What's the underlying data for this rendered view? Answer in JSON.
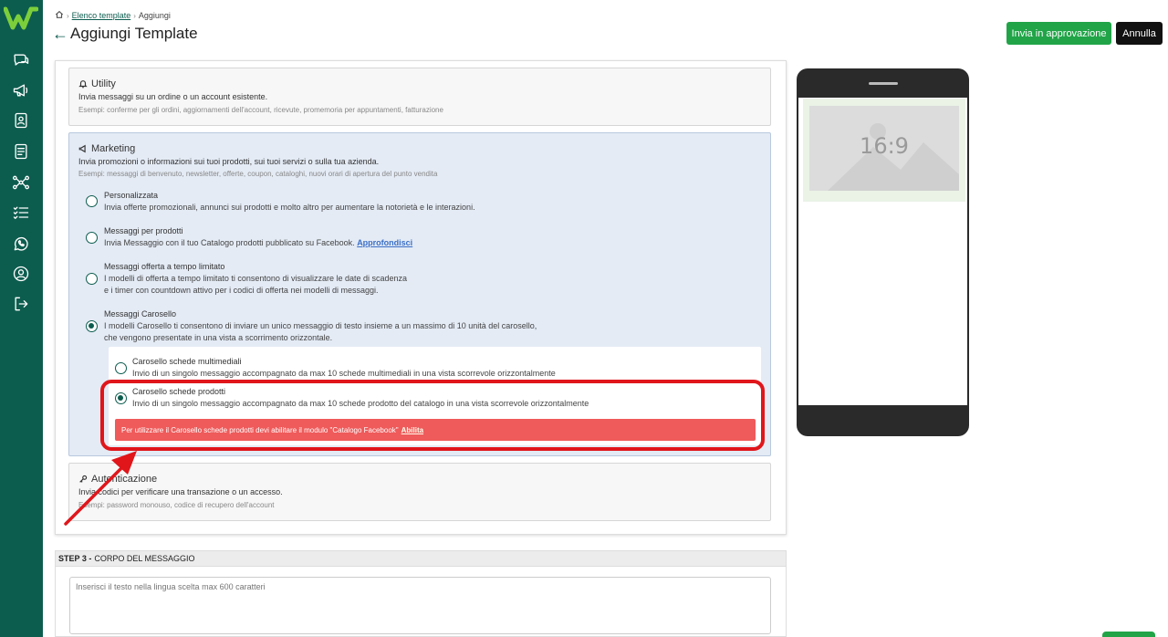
{
  "breadcrumb": {
    "link": "Elenco template",
    "current": "Aggiungi"
  },
  "page": {
    "title": "Aggiungi Template"
  },
  "actions": {
    "approve_label": "Invia in approvazione",
    "cancel_label": "Annulla"
  },
  "categories": {
    "utility": {
      "title": "Utility",
      "desc": "Invia messaggi su un ordine o un account esistente.",
      "example": "Esempi: conferme per gli ordini, aggiornamenti dell'account, ricevute, promemoria per appuntamenti, fatturazione"
    },
    "marketing": {
      "title": "Marketing",
      "desc": "Invia promozioni o informazioni sui tuoi prodotti, sui tuoi servizi o sulla tua azienda.",
      "example": "Esempi: messaggi di benvenuto, newsletter, offerte, coupon, cataloghi, nuovi orari di apertura del punto vendita",
      "options": [
        {
          "title": "Personalizzata",
          "desc": "Invia offerte promozionali, annunci sui prodotti e molto altro per aumentare la notorietà e le interazioni.",
          "checked": false
        },
        {
          "title": "Messaggi per prodotti",
          "desc": "Invia Messaggio con il tuo Catalogo prodotti pubblicato su Facebook.",
          "link": "Approfondisci",
          "checked": false
        },
        {
          "title": "Messaggi offerta a tempo limitato",
          "desc1": "I modelli di offerta a tempo limitato ti consentono di visualizzare le date di scadenza",
          "desc2": "e i timer con countdown attivo per i codici di offerta nei modelli di messaggi.",
          "checked": false
        },
        {
          "title": "Messaggi Carosello",
          "desc1": "I modelli Carosello ti consentono di inviare un unico messaggio di testo insieme a un massimo di 10 unità del carosello,",
          "desc2": "che vengono presentate in una vista a scorrimento orizzontale.",
          "checked": true
        }
      ],
      "carousel_options": [
        {
          "title": "Carosello schede multimediali",
          "desc": "Invio di un singolo messaggio accompagnato da max 10 schede multimediali in una vista scorrevole orizzontalmente",
          "checked": false
        },
        {
          "title": "Carosello schede prodotti",
          "desc": "Invio di un singolo messaggio accompagnato da max 10 schede prodotto del catalogo in una vista scorrevole orizzontalmente",
          "checked": true
        }
      ],
      "alert": {
        "text": "Per utilizzare il Carosello schede prodotti devi abilitare il modulo \"Catalogo Facebook\"",
        "link": "Abilita"
      }
    },
    "auth": {
      "title": "Autenticazione",
      "desc": "Invia codici per verificare una transazione o un accesso.",
      "example": "Esempi: password monouso, codice di recupero dell'account"
    }
  },
  "step3": {
    "label_bold": "STEP 3 -",
    "label": "CORPO DEL MESSAGGIO",
    "placeholder": "Inserisci il testo nella lingua scelta max 600 caratteri"
  },
  "preview": {
    "ratio": "16:9"
  },
  "colors": {
    "brand": "#0d5d4f",
    "approve": "#21a448",
    "alert": "#ef5a5a",
    "highlight": "#e0161b"
  },
  "sidebar": {
    "items": [
      {
        "icon": "chat-icon"
      },
      {
        "icon": "megaphone-icon"
      },
      {
        "icon": "contacts-icon"
      },
      {
        "icon": "document-icon"
      },
      {
        "icon": "flow-icon"
      },
      {
        "icon": "checklist-icon"
      },
      {
        "icon": "whatsapp-icon"
      },
      {
        "icon": "user-icon"
      },
      {
        "icon": "logout-icon"
      }
    ]
  }
}
